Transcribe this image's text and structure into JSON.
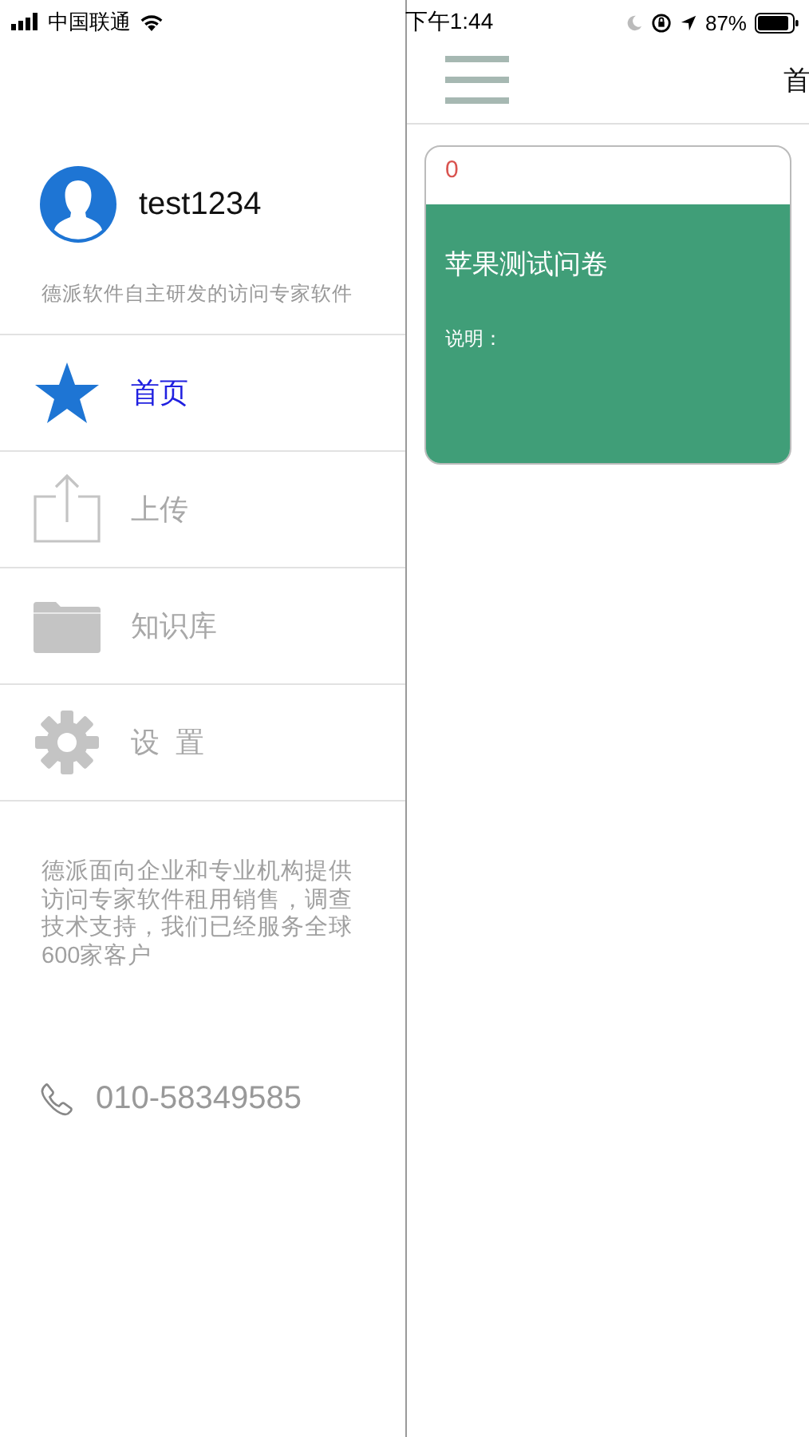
{
  "status_bar": {
    "carrier": "中国联通",
    "time": "下午1:44",
    "battery": "87%"
  },
  "drawer": {
    "user": {
      "name": "test1234"
    },
    "tagline": "德派软件自主研发的访问专家软件",
    "menu": [
      {
        "label": "首页",
        "kind": "star",
        "selected": true
      },
      {
        "label": "上传",
        "kind": "upload",
        "selected": false
      },
      {
        "label": "知识库",
        "kind": "folder",
        "selected": false
      },
      {
        "label": "设  置",
        "kind": "gear",
        "selected": false
      }
    ],
    "about": "德派面向企业和专业机构提供访问专家软件租用销售，调查技术支持，我们已经服务全球600家客户",
    "phone": "010-58349585"
  },
  "main": {
    "title": "首",
    "cards": [
      {
        "count": "0",
        "title": "苹果测试问卷",
        "description": "说明："
      }
    ]
  }
}
